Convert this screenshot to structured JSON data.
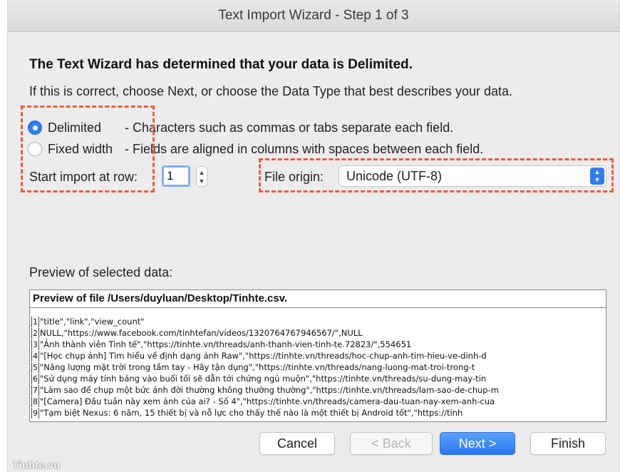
{
  "window": {
    "title": "Text Import Wizard - Step 1 of 3"
  },
  "heading": "The Text Wizard has determined that your data is Delimited.",
  "subheading": "If this is correct, choose Next, or choose the Data Type that best describes your data.",
  "data_type": {
    "options": [
      {
        "label": "Delimited",
        "description": "- Characters such as commas or tabs separate each field.",
        "selected": true
      },
      {
        "label": "Fixed width",
        "description": "- Fields are aligned in columns with spaces between each field.",
        "selected": false
      }
    ]
  },
  "start_row": {
    "label": "Start import at row:",
    "value": "1"
  },
  "file_origin": {
    "label": "File origin:",
    "value": "Unicode (UTF-8)"
  },
  "preview": {
    "label": "Preview of selected data:",
    "header": "Preview of file /Users/duyluan/Desktop/Tinhte.csv.",
    "rows": [
      {
        "num": "1",
        "text": "\"title\",\"link\",\"view_count\""
      },
      {
        "num": "2",
        "text": "NULL,\"https://www.facebook.com/tinhtefan/videos/1320764767946567/\",NULL"
      },
      {
        "num": "3",
        "text": "\"Ảnh thành viên Tinh tế\",\"https://tinhte.vn/threads/anh-thanh-vien-tinh-te.72823/\",554651"
      },
      {
        "num": "4",
        "text": "\"[Học chụp ảnh] Tìm hiểu về định dạng ảnh Raw\",\"https://tinhte.vn/threads/hoc-chup-anh-tim-hieu-ve-dinh-d"
      },
      {
        "num": "5",
        "text": "\"Năng lượng mặt trời trong tầm tay - Hãy tận dụng\",\"https://tinhte.vn/threads/nang-luong-mat-troi-trong-t"
      },
      {
        "num": "6",
        "text": "\"Sử dụng máy tính bảng vào buổi tối sẽ dẫn tới chứng ngủ muộn\",\"https://tinhte.vn/threads/su-dung-may-tin"
      },
      {
        "num": "7",
        "text": "\"Làm sao để chụp một bức ảnh đời thường không thường thường\",\"https://tinhte.vn/threads/lam-sao-de-chup-m"
      },
      {
        "num": "8",
        "text": "\"[Camera] Đầu tuần này xem ảnh của ai? - Số 4\",\"https://tinhte.vn/threads/camera-dau-tuan-nay-xem-anh-cua"
      },
      {
        "num": "9",
        "text": "\"Tạm biệt Nexus: 6 năm, 15 thiết bị và nỗ lực cho thấy thế nào là một thiết bị Android tốt\",\"https://tinh"
      }
    ]
  },
  "buttons": {
    "cancel": "Cancel",
    "back": "< Back",
    "next": "Next >",
    "finish": "Finish"
  },
  "watermark": "Tinhte.vn",
  "colors": {
    "accent": "#2f7cf6",
    "highlight_dash": "#ee5b45"
  }
}
